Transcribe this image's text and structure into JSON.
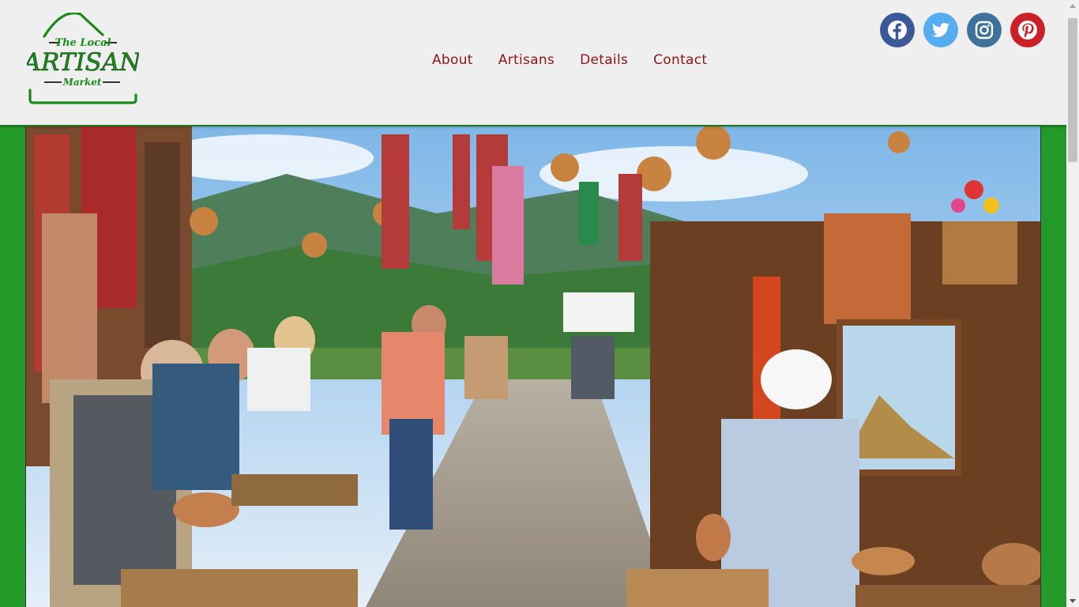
{
  "logo": {
    "line1": "The Local",
    "line2": "ARTISAN",
    "line3": "Market",
    "color": "#1a8a1a"
  },
  "nav": {
    "items": [
      "About",
      "Artisans",
      "Details",
      "Contact"
    ],
    "color": "#8f1414"
  },
  "social": [
    {
      "icon": "facebook-icon",
      "color": "#3b5998"
    },
    {
      "icon": "twitter-icon",
      "color": "#55acee"
    },
    {
      "icon": "instagram-icon",
      "color": "#3f729b"
    },
    {
      "icon": "pinterest-icon",
      "color": "#cb2027"
    }
  ],
  "colors": {
    "page_background": "#249a2a",
    "header_background": "#efefef"
  },
  "hero": {
    "image": "outdoor artisan market with pottery, textiles, paintings and shoppers under a mountain sky"
  }
}
